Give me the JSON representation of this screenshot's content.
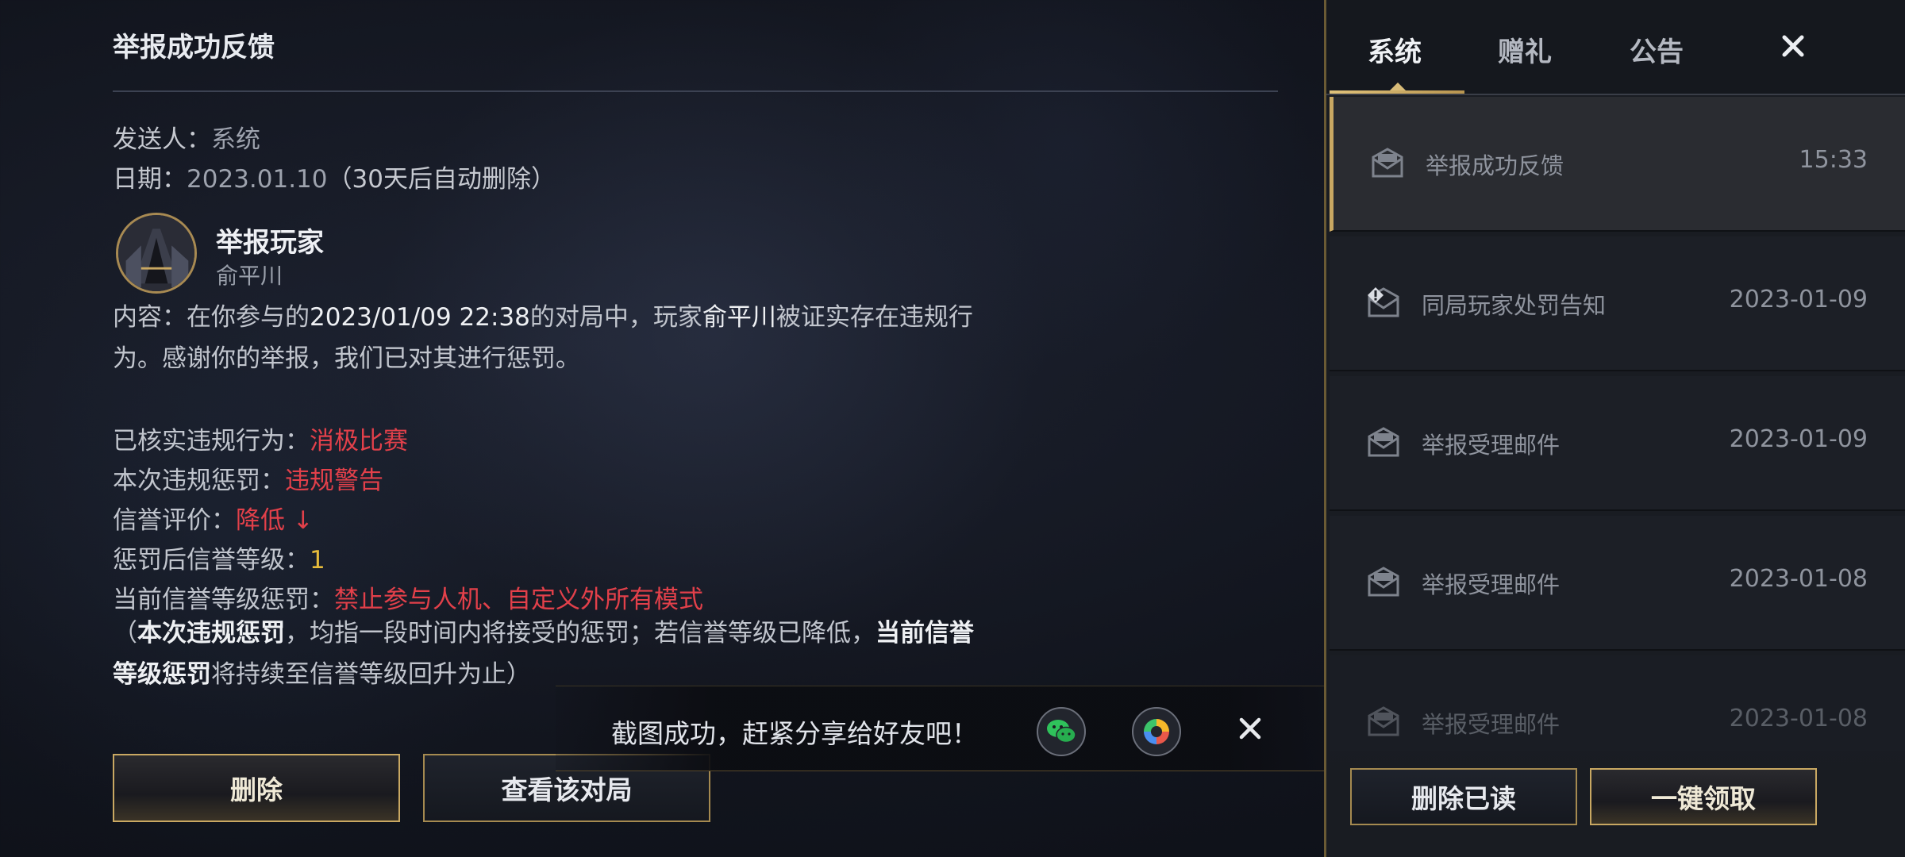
{
  "mail_detail": {
    "title": "举报成功反馈",
    "sender_label": "发送人：",
    "sender_value": "系统",
    "date_label": "日期：",
    "date_value": "2023.01.10",
    "date_note": "（30天后自动删除）",
    "report_title": "举报玩家",
    "reported_player": "俞平川",
    "content_prefix": "内容：在你参与的",
    "content_time": "2023/01/09 22:38",
    "content_mid": "的对局中，玩家",
    "content_player": "俞平川",
    "content_suffix": "被证实存在违规行为。感谢你的举报，我们已对其进行惩罚。",
    "violation_label": "已核实违规行为：",
    "violation_value": "消极比赛",
    "penalty_label": "本次违规惩罚：",
    "penalty_value": "违规警告",
    "credit_label": "信誉评价：",
    "credit_value": "降低 ↓",
    "level_label": "惩罚后信誉等级：",
    "level_value": "1",
    "current_penalty_label": "当前信誉等级惩罚：",
    "current_penalty_value": "禁止参与人机、自定义外所有模式",
    "note_open": "（",
    "note_bold1": "本次违规惩罚",
    "note_mid": "，均指一段时间内将接受的惩罚；若信誉等级已降低，",
    "note_bold2": "当前信誉等级惩罚",
    "note_end": "将持续至信誉等级回升为止）",
    "delete_button": "删除",
    "view_match_button": "查看该对局"
  },
  "toast": {
    "text": "截图成功，赶紧分享给好友吧！",
    "icons": [
      "wechat-icon",
      "moments-icon",
      "close-icon"
    ]
  },
  "sidebar": {
    "tabs": [
      {
        "label": "系统",
        "active": true
      },
      {
        "label": "赠礼",
        "active": false
      },
      {
        "label": "公告",
        "active": false
      }
    ],
    "close_icon": "close-icon",
    "mails": [
      {
        "subject": "举报成功反馈",
        "time": "15:33",
        "icon": "mail-icon",
        "selected": true
      },
      {
        "subject": "同局玩家处罚告知",
        "time": "2023-01-09",
        "icon": "mail-alert-icon",
        "selected": false
      },
      {
        "subject": "举报受理邮件",
        "time": "2023-01-09",
        "icon": "mail-icon",
        "selected": false
      },
      {
        "subject": "举报受理邮件",
        "time": "2023-01-08",
        "icon": "mail-icon",
        "selected": false
      },
      {
        "subject": "举报受理邮件",
        "time": "2023-01-08",
        "icon": "mail-icon",
        "selected": false
      }
    ],
    "delete_read_button": "删除已读",
    "claim_all_button": "一键领取"
  },
  "colors": {
    "accent_gold": "#c9a862",
    "penalty_red": "#e2404a",
    "level_yellow": "#e6bb3b"
  }
}
